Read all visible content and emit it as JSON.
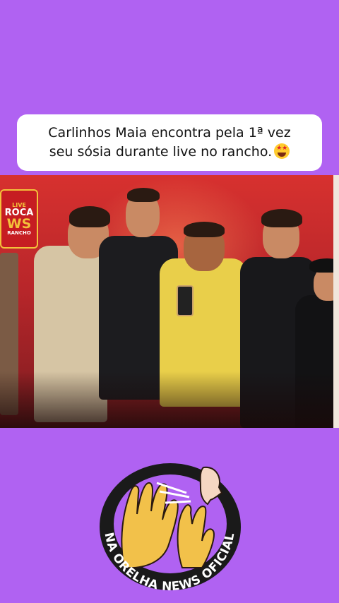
{
  "caption": {
    "line1": "Carlinhos Maia encontra pela 1ª vez",
    "line2": "seu sósia durante live no rancho."
  },
  "video": {
    "overlay_logo": {
      "top": "LIVE",
      "line1": "ROCA",
      "line2": "WS",
      "bottom": "RANCHO"
    }
  },
  "brand": {
    "name": "NA ORELHA NEWS OFICIAL"
  },
  "colors": {
    "background": "#b062f2",
    "card": "#ffffff",
    "logo_ring": "#1a1a1a",
    "logo_inner": "#b062f2",
    "hands": "#f2c14a"
  },
  "icons": {
    "caption_emoji": "star-struck-emoji",
    "brand": "hands-whisper-logo"
  }
}
